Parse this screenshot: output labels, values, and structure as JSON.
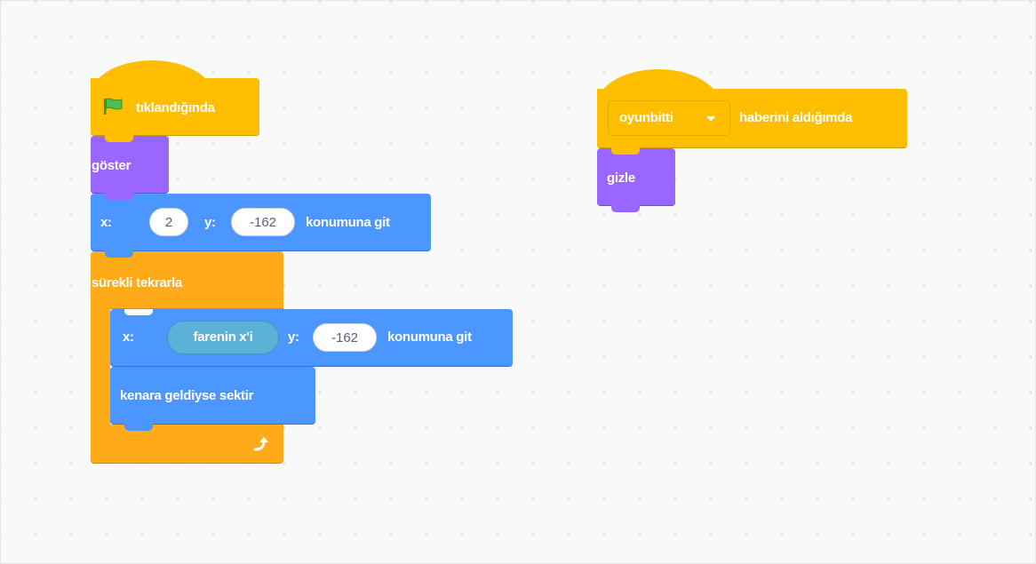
{
  "scripts": {
    "main": {
      "when_flag": {
        "label": "tıklandığında",
        "icon": "green-flag-icon",
        "color": "#ffbf00"
      },
      "show": {
        "label": "göster",
        "color": "#9966ff"
      },
      "go_to_xy": {
        "x_label": "x:",
        "x_value": "2",
        "y_label": "y:",
        "y_value": "-162",
        "suffix": "konumuna git",
        "color": "#4c97ff"
      },
      "forever": {
        "label": "sürekli tekrarla",
        "loop_icon": "loop-arrow-icon",
        "color": "#ffab19",
        "inner": {
          "go_to_xy": {
            "x_label": "x:",
            "x_reporter": "farenin x'i",
            "y_label": "y:",
            "y_value": "-162",
            "suffix": "konumuna git",
            "reporter_color": "#5cb1d6"
          },
          "bounce": {
            "label": "kenara geldiyse sektir"
          }
        }
      }
    },
    "broadcast": {
      "when_receive": {
        "dropdown_value": "oyunbitti",
        "dropdown_icon": "chevron-down-icon",
        "suffix": "haberini aldığımda",
        "color": "#ffbf00"
      },
      "hide": {
        "label": "gizle",
        "color": "#9966ff"
      }
    }
  }
}
